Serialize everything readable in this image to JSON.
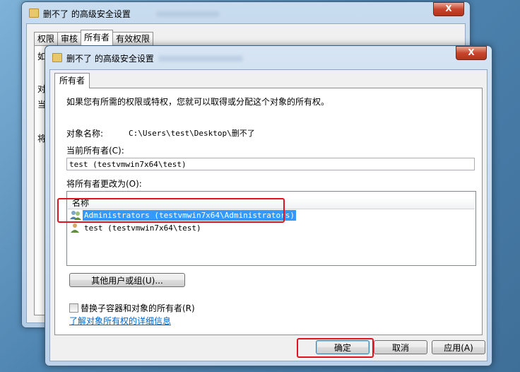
{
  "back_window": {
    "title": "删不了 的高级安全设置",
    "close": "X",
    "tabs": [
      "权限",
      "审核",
      "所有者",
      "有效权限"
    ],
    "active_tab": 2,
    "scraps": [
      "如",
      "对",
      "当",
      "将"
    ]
  },
  "dialog": {
    "title": "删不了 的高级安全设置",
    "close": "X",
    "tab": "所有者",
    "intro": "如果您有所需的权限或特权，您就可以取得或分配这个对象的所有权。",
    "object_name_label": "对象名称:",
    "object_name_value": "C:\\Users\\test\\Desktop\\删不了",
    "current_owner_label": "当前所有者(C):",
    "current_owner_value": "test (testvmwin7x64\\test)",
    "change_owner_label": "将所有者更改为(O):",
    "list_header": "名称",
    "list_items": [
      {
        "name": "Administrators (testvmwin7x64\\Administrators)",
        "selected": true,
        "icon": "group-icon"
      },
      {
        "name": "test (testvmwin7x64\\test)",
        "selected": false,
        "icon": "user-icon"
      }
    ],
    "other_users_button": "其他用户或组(U)...",
    "replace_checkbox_label": "替换子容器和对象的所有者(R)",
    "learn_more_link": "了解对象所有权的详细信息",
    "ok_button": "确定",
    "cancel_button": "取消",
    "apply_button": "应用(A)"
  },
  "colors": {
    "highlight": "#3399ff",
    "annotation": "#e0141e",
    "link": "#0066cc"
  }
}
